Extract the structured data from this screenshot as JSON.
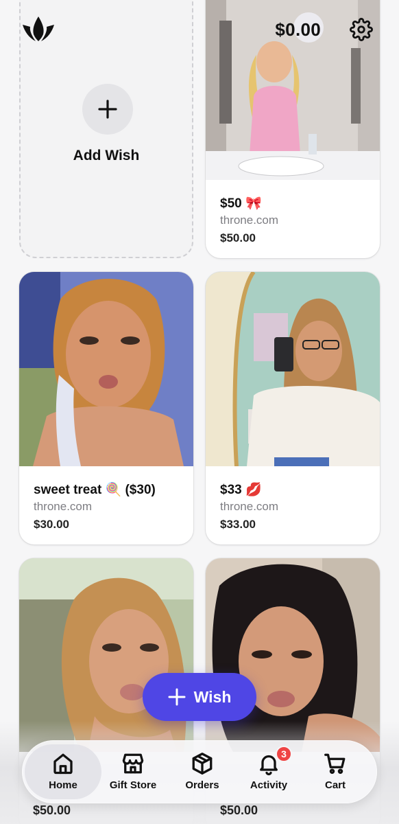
{
  "header": {
    "balance": "$0.00",
    "logo_icon": "crown-logo-icon",
    "settings_icon": "gear-icon"
  },
  "add_wish": {
    "label": "Add Wish",
    "icon": "plus-icon"
  },
  "wishes": [
    {
      "title": "$50 🎀",
      "site": "throne.com",
      "price": "$50.00"
    },
    {
      "title": "sweet treat 🍭 ($30)",
      "site": "throne.com",
      "price": "$30.00"
    },
    {
      "title": "$33 💋",
      "site": "throne.com",
      "price": "$33.00"
    },
    {
      "title": "",
      "site": "",
      "price": "$50.00"
    },
    {
      "title": "",
      "site": "",
      "price": "$50.00"
    }
  ],
  "fab": {
    "label": "Wish",
    "icon": "plus-icon"
  },
  "nav": {
    "items": [
      {
        "label": "Home",
        "icon": "home-icon",
        "active": true
      },
      {
        "label": "Gift Store",
        "icon": "store-icon"
      },
      {
        "label": "Orders",
        "icon": "box-icon"
      },
      {
        "label": "Activity",
        "icon": "bell-icon",
        "badge": "3"
      },
      {
        "label": "Cart",
        "icon": "cart-icon"
      }
    ]
  },
  "colors": {
    "accent": "#4f46e5",
    "badge": "#ef4444",
    "background": "#f6f6f7"
  }
}
